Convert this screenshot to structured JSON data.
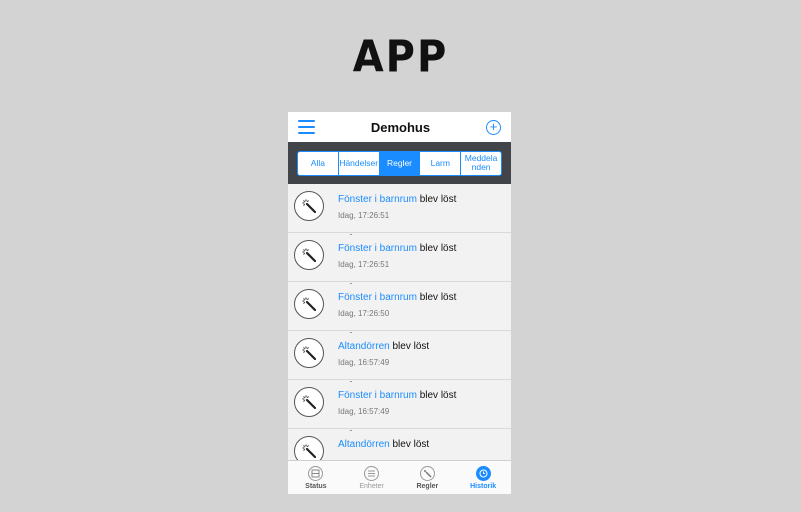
{
  "brand": "APP",
  "nav": {
    "title": "Demohus",
    "menu_icon": "hamburger-icon",
    "add_icon": "plus-circle-icon"
  },
  "segments": [
    {
      "label": "Alla",
      "active": false
    },
    {
      "label": "Händelser",
      "active": false
    },
    {
      "label": "Regler",
      "active": true
    },
    {
      "label": "Larm",
      "active": false
    },
    {
      "label": "Meddelanden",
      "active": false
    }
  ],
  "events": [
    {
      "subject": "Fönster i barnrum",
      "action": " blev löst",
      "time": "Idag, 17:26:51",
      "icon": "magic-wand-icon"
    },
    {
      "subject": "Fönster i barnrum",
      "action": " blev löst",
      "time": "Idag, 17:26:51",
      "icon": "magic-wand-icon"
    },
    {
      "subject": "Fönster i barnrum",
      "action": " blev löst",
      "time": "Idag, 17:26:50",
      "icon": "magic-wand-icon"
    },
    {
      "subject": "Altandörren",
      "action": " blev löst",
      "time": "Idag, 16:57:49",
      "icon": "magic-wand-icon"
    },
    {
      "subject": "Fönster i barnrum",
      "action": " blev löst",
      "time": "Idag, 16:57:49",
      "icon": "magic-wand-icon"
    },
    {
      "subject": "Altandörren",
      "action": " blev löst",
      "time": "",
      "icon": "magic-wand-icon"
    }
  ],
  "tabs": [
    {
      "label": "Status",
      "icon": "status-icon",
      "state": "normal"
    },
    {
      "label": "Enheter",
      "icon": "list-icon",
      "state": "dim"
    },
    {
      "label": "Regler",
      "icon": "magic-wand-icon",
      "state": "normal"
    },
    {
      "label": "Historik",
      "icon": "clock-icon",
      "state": "active"
    }
  ],
  "colors": {
    "accent": "#1a8cff",
    "segbar_bg": "#414549",
    "page_bg": "#d3d3d3"
  }
}
